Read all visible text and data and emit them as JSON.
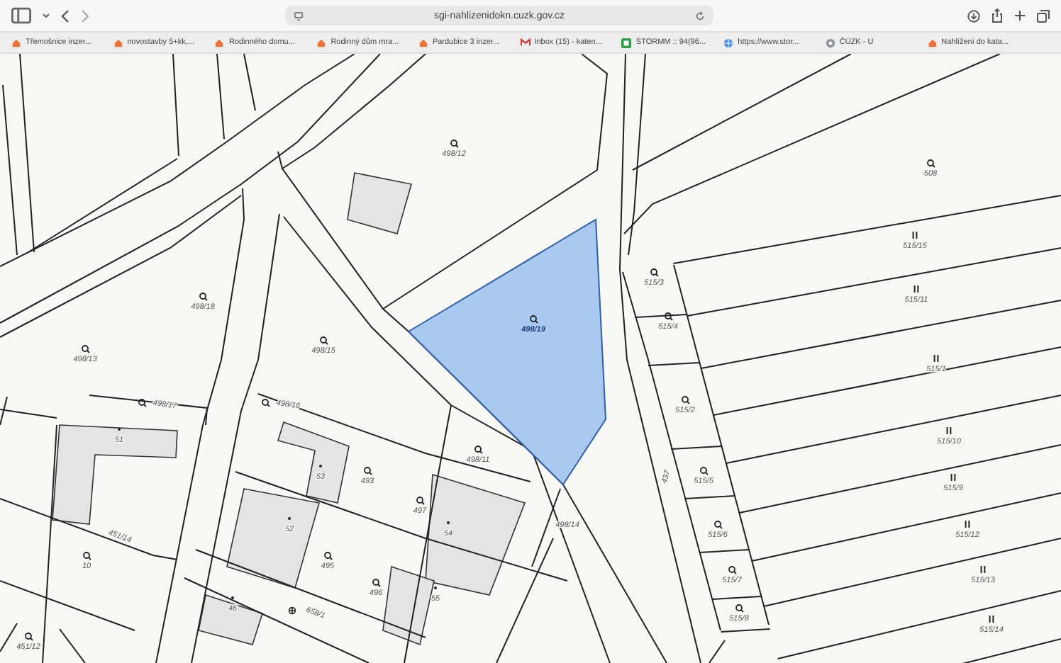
{
  "browser": {
    "url": "sgi-nahlizenidokn.cuzk.gov.cz",
    "bookmarks": [
      {
        "label": "Třemošnice inzer...",
        "kind": "realty"
      },
      {
        "label": "novostavby 5+kk,...",
        "kind": "realty"
      },
      {
        "label": "Rodinného domu...",
        "kind": "realty"
      },
      {
        "label": "Rodinný dům mra...",
        "kind": "realty"
      },
      {
        "label": "Pardubice 3 inzer...",
        "kind": "realty"
      },
      {
        "label": "Inbox (15) - katen...",
        "kind": "mail"
      },
      {
        "label": "STORMM :: 94(96...",
        "kind": "app"
      },
      {
        "label": "https://www.stor...",
        "kind": "globe"
      },
      {
        "label": "ČÚZK - U",
        "kind": "state"
      },
      {
        "label": "Nahlížení do kata...",
        "kind": "realty"
      }
    ]
  },
  "map": {
    "parcels": [
      {
        "number": "498/12",
        "kind": "garden",
        "selected": false
      },
      {
        "number": "508",
        "kind": "garden",
        "selected": false
      },
      {
        "number": "515/15",
        "kind": "arable",
        "selected": false
      },
      {
        "number": "515/3",
        "kind": "garden",
        "selected": false
      },
      {
        "number": "515/11",
        "kind": "arable",
        "selected": false
      },
      {
        "number": "498/18",
        "kind": "garden",
        "selected": false
      },
      {
        "number": "498/19",
        "kind": "garden",
        "selected": true
      },
      {
        "number": "515/4",
        "kind": "garden",
        "selected": false
      },
      {
        "number": "498/15",
        "kind": "garden",
        "selected": false
      },
      {
        "number": "498/13",
        "kind": "garden",
        "selected": false
      },
      {
        "number": "515/1",
        "kind": "arable",
        "selected": false
      },
      {
        "number": "498/17",
        "kind": "garden",
        "selected": false
      },
      {
        "number": "498/16",
        "kind": "garden",
        "selected": false
      },
      {
        "number": "515/2",
        "kind": "garden",
        "selected": false
      },
      {
        "number": "515/10",
        "kind": "arable",
        "selected": false
      },
      {
        "number": "51",
        "kind": "building",
        "selected": false
      },
      {
        "number": "498/11",
        "kind": "garden",
        "selected": false
      },
      {
        "number": "515/5",
        "kind": "garden",
        "selected": false
      },
      {
        "number": "53",
        "kind": "building",
        "selected": false
      },
      {
        "number": "493",
        "kind": "garden",
        "selected": false
      },
      {
        "number": "515/9",
        "kind": "arable",
        "selected": false
      },
      {
        "number": "437",
        "kind": "road",
        "selected": false
      },
      {
        "number": "497",
        "kind": "garden",
        "selected": false
      },
      {
        "number": "498/14",
        "kind": "road",
        "selected": false
      },
      {
        "number": "52",
        "kind": "building",
        "selected": false
      },
      {
        "number": "54",
        "kind": "building",
        "selected": false
      },
      {
        "number": "451/14",
        "kind": "road",
        "selected": false
      },
      {
        "number": "515/6",
        "kind": "garden",
        "selected": false
      },
      {
        "number": "515/12",
        "kind": "arable",
        "selected": false
      },
      {
        "number": "10",
        "kind": "garden",
        "selected": false
      },
      {
        "number": "495",
        "kind": "garden",
        "selected": false
      },
      {
        "number": "515/7",
        "kind": "garden",
        "selected": false
      },
      {
        "number": "515/13",
        "kind": "arable",
        "selected": false
      },
      {
        "number": "496",
        "kind": "garden",
        "selected": false
      },
      {
        "number": "55",
        "kind": "building",
        "selected": false
      },
      {
        "number": "46",
        "kind": "building",
        "selected": false
      },
      {
        "number": "658/1",
        "kind": "cross",
        "selected": false
      },
      {
        "number": "515/8",
        "kind": "garden",
        "selected": false
      },
      {
        "number": "515/14",
        "kind": "arable",
        "selected": false
      },
      {
        "number": "451/12",
        "kind": "garden",
        "selected": false
      }
    ]
  }
}
